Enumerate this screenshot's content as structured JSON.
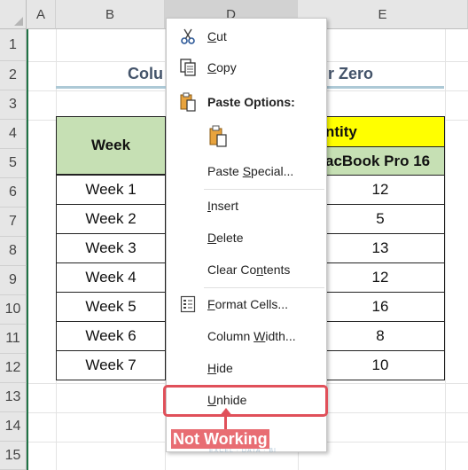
{
  "columns": [
    "A",
    "B",
    "D",
    "E"
  ],
  "rows": [
    "1",
    "2",
    "3",
    "4",
    "5",
    "6",
    "7",
    "8",
    "9",
    "10",
    "11",
    "12",
    "13",
    "14",
    "15"
  ],
  "sheet": {
    "title_left": "Colu",
    "title_right": "r Zero",
    "header_week": "Week",
    "header_quantity": "ntity",
    "header_product": "acBook Pro 16",
    "weeks": [
      "Week 1",
      "Week 2",
      "Week 3",
      "Week 4",
      "Week 5",
      "Week 6",
      "Week 7"
    ],
    "quantities": [
      "12",
      "5",
      "13",
      "12",
      "16",
      "8",
      "10"
    ]
  },
  "menu": {
    "cut_pre": "",
    "cut_u": "C",
    "cut_post": "ut",
    "copy_pre": "",
    "copy_u": "C",
    "copy_post": "opy",
    "paste_options": "Paste Options:",
    "paste_special_pre": "Paste ",
    "paste_special_u": "S",
    "paste_special_post": "pecial...",
    "insert_pre": "",
    "insert_u": "I",
    "insert_post": "nsert",
    "delete_pre": "",
    "delete_u": "D",
    "delete_post": "elete",
    "clear_pre": "Clear Co",
    "clear_u": "n",
    "clear_post": "tents",
    "format_pre": "",
    "format_u": "F",
    "format_post": "ormat Cells...",
    "colwidth_pre": "Column ",
    "colwidth_u": "W",
    "colwidth_post": "idth...",
    "hide_pre": "",
    "hide_u": "H",
    "hide_post": "ide",
    "unhide_pre": "",
    "unhide_u": "U",
    "unhide_post": "nhide"
  },
  "annotation": {
    "label": "Not Working",
    "watermark": "exceldemy",
    "watermark_sub": "EXCEL · DATA · BI"
  },
  "colors": {
    "highlight": "#e0505a",
    "green_header": "#c6e0b4",
    "yellow_header": "#ffff00"
  }
}
